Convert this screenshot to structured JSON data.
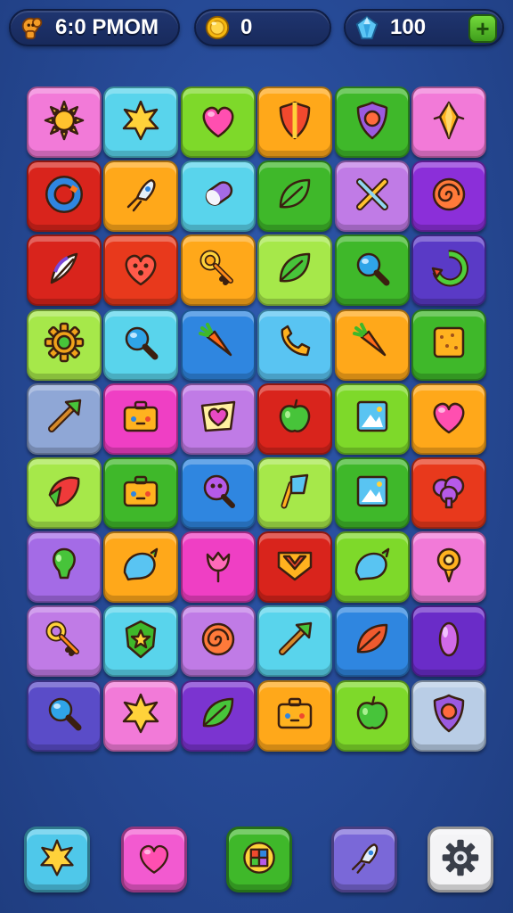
{
  "hud": {
    "time_label": "6:0 ΡΜΟΜ",
    "coins_value": "0",
    "gems_value": "100",
    "time_icon": "character-icon",
    "coin_icon": "coin-icon",
    "gem_icon": "gem-icon",
    "plus_icon": "plus-icon"
  },
  "board": {
    "rows": 9,
    "columns": 6,
    "tiles": [
      {
        "color": "#f27ad8",
        "icon": "sun"
      },
      {
        "color": "#59d4ec",
        "icon": "star-burst"
      },
      {
        "color": "#7ed92a",
        "icon": "heart"
      },
      {
        "color": "#ffa81a",
        "icon": "shield"
      },
      {
        "color": "#3fb82a",
        "icon": "shield-gem"
      },
      {
        "color": "#f27ad8",
        "icon": "crystal"
      },
      {
        "color": "#d9241c",
        "icon": "ring"
      },
      {
        "color": "#ffa81a",
        "icon": "rocket"
      },
      {
        "color": "#59d4ec",
        "icon": "capsule"
      },
      {
        "color": "#3fb82a",
        "icon": "leaf"
      },
      {
        "color": "#c07be6",
        "icon": "crossed-tools"
      },
      {
        "color": "#8b2fd9",
        "icon": "spiral"
      },
      {
        "color": "#d9241c",
        "icon": "feather"
      },
      {
        "color": "#e8391c",
        "icon": "heart-face"
      },
      {
        "color": "#ffa81a",
        "icon": "key"
      },
      {
        "color": "#a6e84a",
        "icon": "leaf"
      },
      {
        "color": "#3fb82a",
        "icon": "magnifier"
      },
      {
        "color": "#5a3ac6",
        "icon": "recycle"
      },
      {
        "color": "#a6e84a",
        "icon": "gear"
      },
      {
        "color": "#59d4ec",
        "icon": "magnifier"
      },
      {
        "color": "#2f86e0",
        "icon": "carrot"
      },
      {
        "color": "#59c4f2",
        "icon": "phone"
      },
      {
        "color": "#ffa81a",
        "icon": "carrot"
      },
      {
        "color": "#3fb82a",
        "icon": "cracker"
      },
      {
        "color": "#8fa7d6",
        "icon": "arrow"
      },
      {
        "color": "#ef3fc4",
        "icon": "suitcase"
      },
      {
        "color": "#c07be6",
        "icon": "heart-badge"
      },
      {
        "color": "#d9241c",
        "icon": "apple"
      },
      {
        "color": "#7ed92a",
        "icon": "picture"
      },
      {
        "color": "#ffa81a",
        "icon": "heart"
      },
      {
        "color": "#a6e84a",
        "icon": "strawberry"
      },
      {
        "color": "#3fb82a",
        "icon": "suitcase"
      },
      {
        "color": "#2f86e0",
        "icon": "lollipop"
      },
      {
        "color": "#a6e84a",
        "icon": "flag"
      },
      {
        "color": "#3fb82a",
        "icon": "picture"
      },
      {
        "color": "#e8391c",
        "icon": "tree"
      },
      {
        "color": "#a46be6",
        "icon": "balloon"
      },
      {
        "color": "#ffa81a",
        "icon": "bubble"
      },
      {
        "color": "#ef3fc4",
        "icon": "tulip"
      },
      {
        "color": "#d9241c",
        "icon": "badge"
      },
      {
        "color": "#7ed92a",
        "icon": "bubble"
      },
      {
        "color": "#f27ad8",
        "icon": "pin"
      },
      {
        "color": "#c07be6",
        "icon": "key"
      },
      {
        "color": "#59d4ec",
        "icon": "star-shield"
      },
      {
        "color": "#c07be6",
        "icon": "spiral"
      },
      {
        "color": "#59d4ec",
        "icon": "arrow"
      },
      {
        "color": "#2f86e0",
        "icon": "leaf-red"
      },
      {
        "color": "#6a2cc8",
        "icon": "capsule-gem"
      },
      {
        "color": "#5a4cc8",
        "icon": "magnifier"
      },
      {
        "color": "#f27ad8",
        "icon": "star-burst"
      },
      {
        "color": "#7b34d0",
        "icon": "leaf"
      },
      {
        "color": "#ffa81a",
        "icon": "suitcase"
      },
      {
        "color": "#7ed92a",
        "icon": "apple"
      },
      {
        "color": "#b9cde6",
        "icon": "shield-gem"
      }
    ]
  },
  "toolbar": {
    "items": [
      {
        "name": "star-burst-button",
        "icon": "star-burst",
        "color": "#4fc8ea"
      },
      {
        "name": "heart-button",
        "icon": "heart",
        "color": "#f25ad0"
      },
      {
        "name": "color-block-button",
        "icon": "color-block",
        "color": "#3fb82a"
      },
      {
        "name": "rocket-button",
        "icon": "rocket",
        "color": "#7a68d8"
      },
      {
        "name": "settings-button",
        "icon": "gear-settings",
        "color": "#f4f4f6"
      }
    ]
  }
}
